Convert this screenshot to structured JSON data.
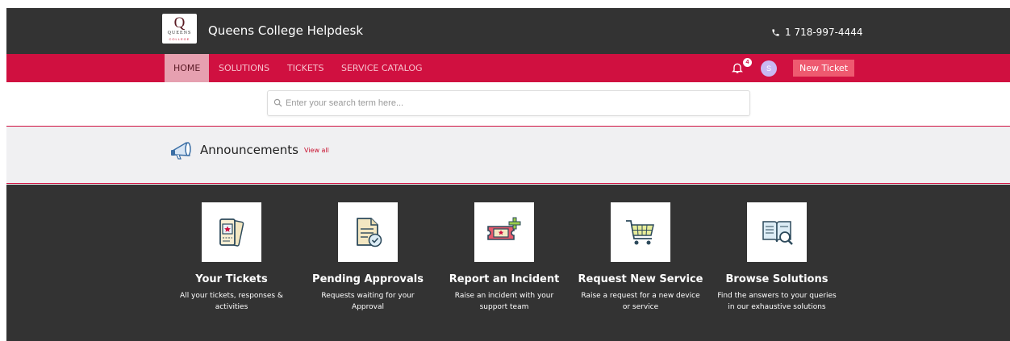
{
  "header": {
    "logo": {
      "letter": "Q",
      "wordmark": "QUEENS",
      "sub": "COLLEGE"
    },
    "site_title": "Queens College Helpdesk",
    "phone": "1 718-997-4444"
  },
  "nav": {
    "items": [
      {
        "label": "HOME",
        "active": true
      },
      {
        "label": "SOLUTIONS",
        "active": false
      },
      {
        "label": "TICKETS",
        "active": false
      },
      {
        "label": "SERVICE CATALOG",
        "active": false
      }
    ],
    "notification_count": "4",
    "avatar_initial": "S",
    "new_ticket_label": "New Ticket"
  },
  "search": {
    "placeholder": "Enter your search term here..."
  },
  "announcements": {
    "title": "Announcements",
    "view_all": "View all"
  },
  "cards": [
    {
      "icon": "ticket-icon",
      "title": "Your Tickets",
      "desc": "All your tickets, responses & activities"
    },
    {
      "icon": "approval-document-icon",
      "title": "Pending Approvals",
      "desc": "Requests waiting for your Approval"
    },
    {
      "icon": "report-incident-icon",
      "title": "Report an Incident",
      "desc": "Raise an incident with your support team"
    },
    {
      "icon": "shopping-cart-icon",
      "title": "Request New Service",
      "desc": "Raise a request for a new device or service"
    },
    {
      "icon": "book-search-icon",
      "title": "Browse Solutions",
      "desc": "Find the answers to your queries in our exhaustive solutions"
    }
  ],
  "colors": {
    "dark": "#333333",
    "brand": "#d01040",
    "button": "#ee5a70",
    "nav_active": "#e6a0b0"
  }
}
